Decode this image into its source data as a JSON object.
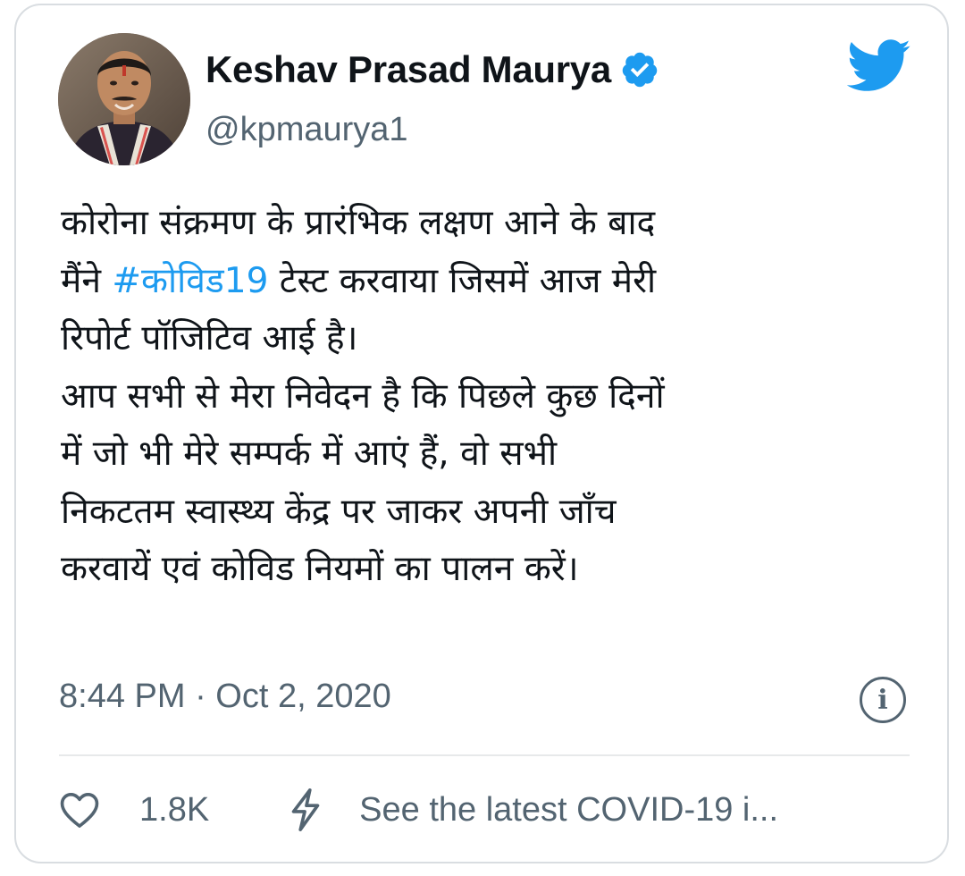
{
  "author": {
    "display_name": "Keshav Prasad Maurya",
    "handle": "@kpmaurya1",
    "verified": true
  },
  "tweet": {
    "lines": [
      [
        {
          "text": "कोरोना संक्रमण के प्रारंभिक लक्षण आने के बाद"
        }
      ],
      [
        {
          "text": "मैंने "
        },
        {
          "text": "#कोविड19",
          "hashtag": true
        },
        {
          "text": " टेस्ट करवाया जिसमें आज मेरी"
        }
      ],
      [
        {
          "text": "रिपोर्ट पॉजिटिव आई है।"
        }
      ],
      [
        {
          "text": "आप सभी से मेरा निवेदन है कि पिछले कुछ दिनों"
        }
      ],
      [
        {
          "text": "में जो भी मेरे सम्पर्क में आएं हैं, वो सभी"
        }
      ],
      [
        {
          "text": "निकटतम स्वास्थ्य केंद्र पर जाकर अपनी जाँच"
        }
      ],
      [
        {
          "text": "करवायें एवं कोविड नियमों का पालन करें।"
        }
      ]
    ],
    "timestamp": "8:44 PM · Oct 2, 2020"
  },
  "actions": {
    "like_count": "1.8K",
    "covid_link": "See the latest COVID-19 i..."
  },
  "icons": {
    "brand": "twitter-bird-icon",
    "verified": "verified-badge-icon",
    "info": "info-icon",
    "like": "heart-icon",
    "covid": "lightning-bolt-icon"
  },
  "colors": {
    "accent": "#1d9bf0",
    "text_primary": "#0f1419",
    "text_secondary": "#536471",
    "border": "#d9dde1"
  }
}
